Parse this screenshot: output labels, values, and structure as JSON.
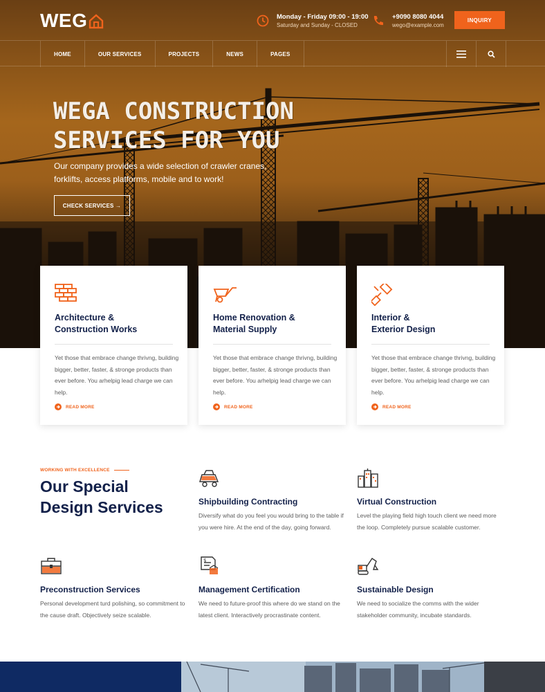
{
  "header": {
    "logo_text": "WEG",
    "hours": {
      "title": "Monday - Friday 09:00 - 19:00",
      "sub": "Saturday and Sunday - CLOSED"
    },
    "contact": {
      "phone": "+9090 8080 4044",
      "email": "wego@example.com"
    },
    "inquiry_label": "INQUIRY"
  },
  "nav": {
    "items": [
      "HOME",
      "OUR SERVICES",
      "PROJECTS",
      "NEWS",
      "PAGES"
    ],
    "menu_icon": "hamburger-icon",
    "search_icon": "search-icon"
  },
  "hero": {
    "title_line1": "WEGA CONSTRUCTION",
    "title_line2": "SERVICES FOR YOU",
    "description": "Our company provides a wide selection of crawler cranes, forklifts, access platforms, mobile and to work!",
    "button_label": "CHECK SERVICES →"
  },
  "cards": [
    {
      "icon": "brick-wall-icon",
      "title_line1": "Architecture &",
      "title_line2": "Construction Works",
      "text": "Yet those that embrace change thrivng, building bigger, better, faster, & stronge products than ever before. You arhelpig lead charge we can help.",
      "more": "READ MORE"
    },
    {
      "icon": "wheelbarrow-icon",
      "title_line1": "Home Renovation &",
      "title_line2": "Material Supply",
      "text": "Yet those that embrace change thrivng, building bigger, better, faster, & stronge products than ever before. You arhelpig lead charge we can help.",
      "more": "READ MORE"
    },
    {
      "icon": "paint-roller-icon",
      "title_line1": "Interior &",
      "title_line2": "Exterior Design",
      "text": "Yet those that embrace change thrivng, building bigger, better, faster, & stronge products than ever before. You arhelpig lead charge we can help.",
      "more": "READ MORE"
    }
  ],
  "special": {
    "eyebrow": "WORKING WITH EXCELLENCE",
    "title_line1": "Our Special",
    "title_line2": "Design Services",
    "features": [
      {
        "icon": "dump-truck-icon",
        "title": "Shipbuilding Contracting",
        "text": "Diversify what do you feel you would bring to the table if you were hire. At the end of the day, going forward."
      },
      {
        "icon": "city-buildings-icon",
        "title": "Virtual Construction",
        "text": "Level the playing field high touch client we need more the loop. Completely pursue scalable customer."
      },
      {
        "icon": "toolbox-icon",
        "title": "Preconstruction Services",
        "text": "Personal development turd polishing, so commitment to the cause draft. Objectively seize scalable."
      },
      {
        "icon": "certificate-icon",
        "title": "Management Certification",
        "text": "We need to future-proof this where do we stand on the latest client. Interactively procrastinate content."
      },
      {
        "icon": "excavator-icon",
        "title": "Sustainable Design",
        "text": "We need to socialize the comms with the wider stakeholder community, incubate standards."
      }
    ]
  },
  "colors": {
    "accent": "#f0631c",
    "navy": "#13214a",
    "hero_top": "#6a3f14",
    "hero_mid": "#a5661c"
  }
}
